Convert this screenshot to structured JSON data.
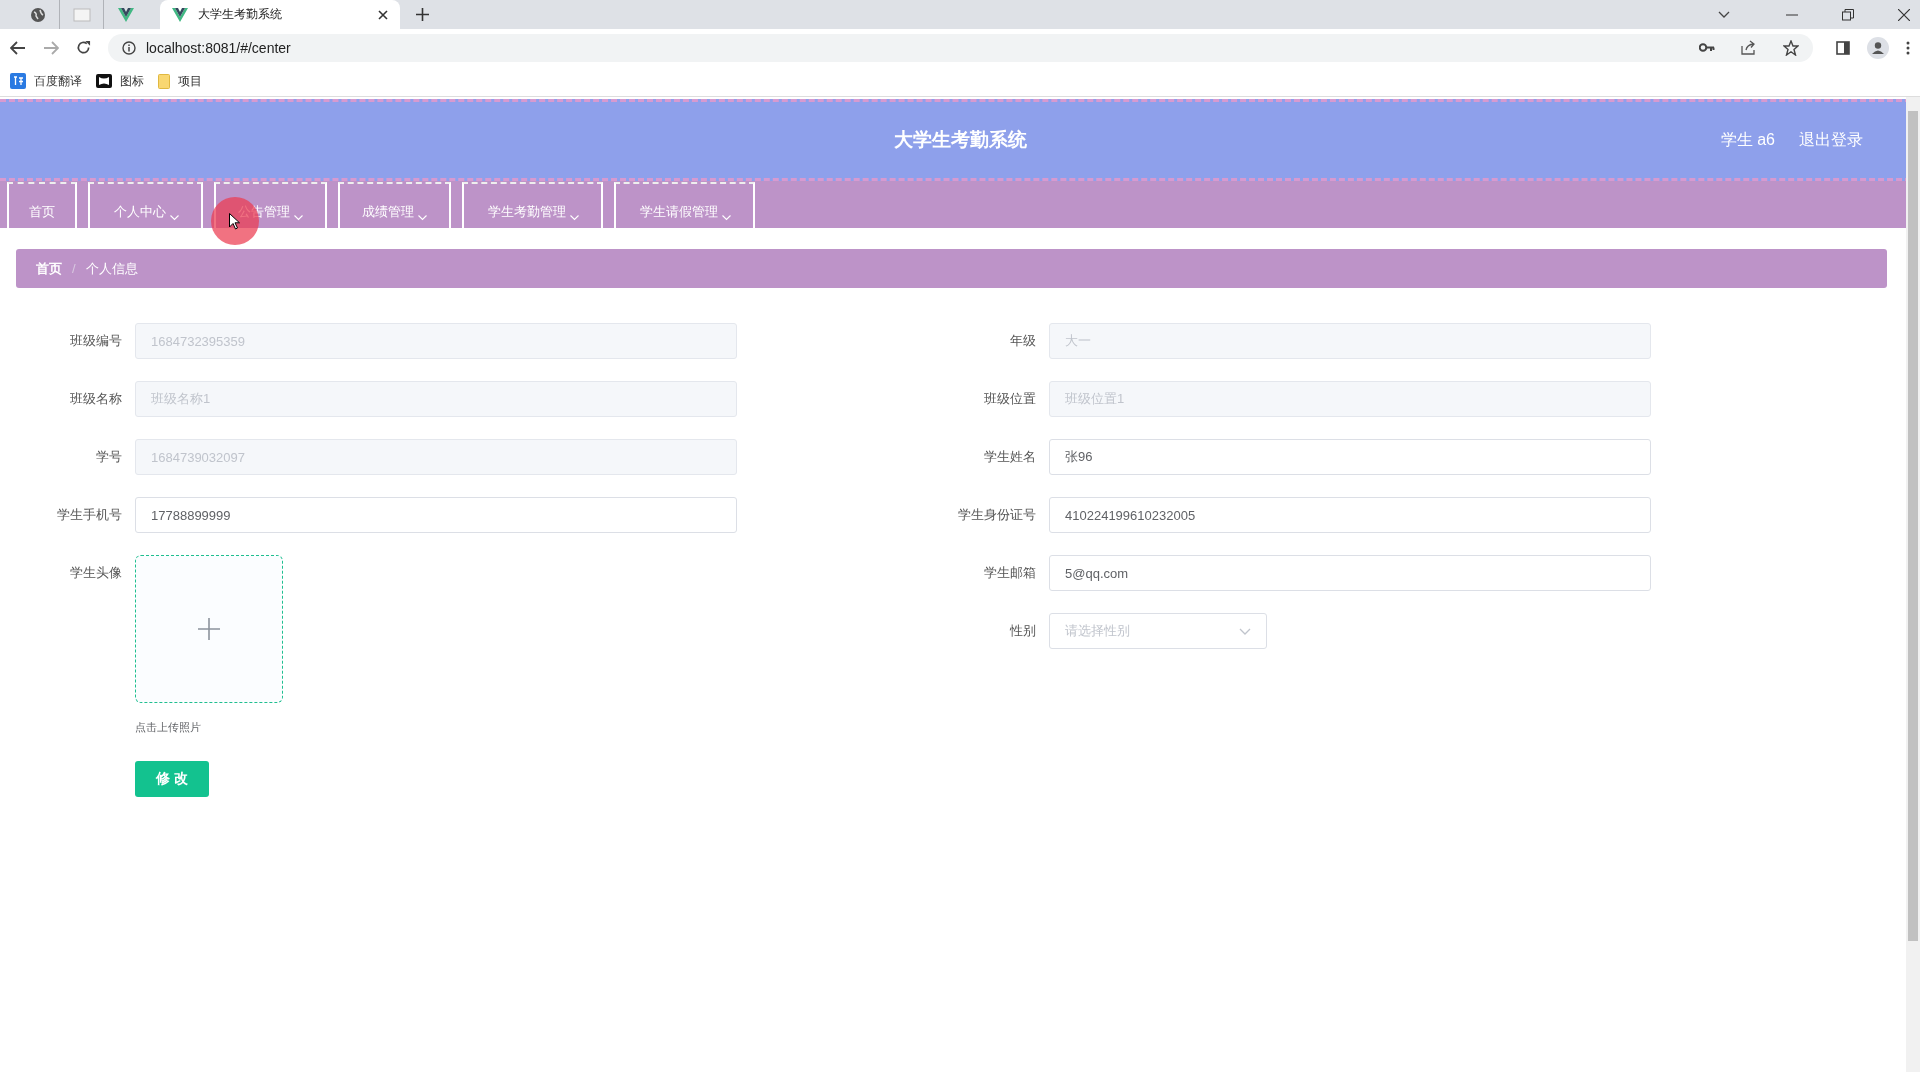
{
  "browser": {
    "tabs": [
      {
        "title": "大学生考勤系统",
        "selected": true
      }
    ],
    "url": "localhost:8081/#/center",
    "bookmarks": [
      {
        "label": "百度翻译"
      },
      {
        "label": "图标"
      },
      {
        "label": "项目"
      }
    ]
  },
  "header": {
    "title": "大学生考勤系统",
    "user": "学生 a6",
    "logout": "退出登录"
  },
  "nav": [
    {
      "label": "首页",
      "dropdown": false
    },
    {
      "label": "个人中心",
      "dropdown": true
    },
    {
      "label": "公告管理",
      "dropdown": true
    },
    {
      "label": "成绩管理",
      "dropdown": true
    },
    {
      "label": "学生考勤管理",
      "dropdown": true
    },
    {
      "label": "学生请假管理",
      "dropdown": true
    }
  ],
  "breadcrumb": {
    "items": [
      "首页",
      "个人信息"
    ],
    "separator": "/"
  },
  "form": {
    "left_fields": [
      {
        "kind": "input",
        "label": "班级编号",
        "value": "1684732395359",
        "disabled": true
      },
      {
        "kind": "input",
        "label": "班级名称",
        "value": "班级名称1",
        "disabled": true
      },
      {
        "kind": "input",
        "label": "学号",
        "value": "1684739032097",
        "disabled": true
      },
      {
        "kind": "input",
        "label": "学生手机号",
        "value": "17788899999",
        "disabled": false
      },
      {
        "kind": "upload",
        "label": "学生头像",
        "hint": "点击上传照片"
      }
    ],
    "right_fields": [
      {
        "kind": "input",
        "label": "年级",
        "value": "大一",
        "disabled": true
      },
      {
        "kind": "input",
        "label": "班级位置",
        "value": "班级位置1",
        "disabled": true
      },
      {
        "kind": "input",
        "label": "学生姓名",
        "value": "张96",
        "disabled": false
      },
      {
        "kind": "input",
        "label": "学生身份证号",
        "value": "410224199610232005",
        "disabled": false
      },
      {
        "kind": "input",
        "label": "学生邮箱",
        "value": "5@qq.com",
        "disabled": false
      },
      {
        "kind": "select",
        "label": "性别",
        "placeholder": "请选择性别"
      }
    ],
    "submit": "修 改"
  }
}
